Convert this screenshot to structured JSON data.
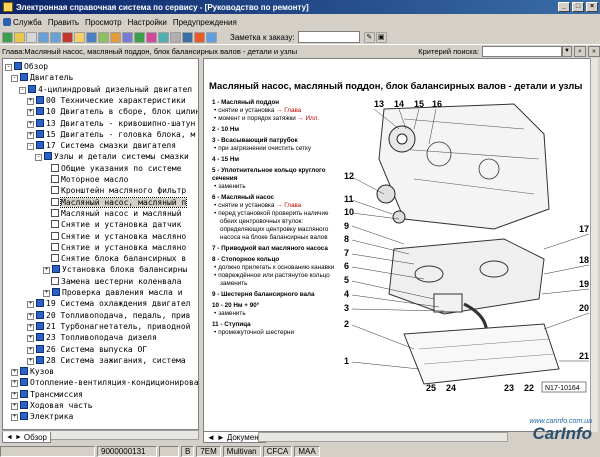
{
  "window": {
    "title": "Электронная справочная система по сервису - [Руководство по ремонту]"
  },
  "menu": [
    {
      "label": "Служба"
    },
    {
      "label": "Править"
    },
    {
      "label": "Просмотр"
    },
    {
      "label": "Настройки"
    },
    {
      "label": "Предупреждения"
    }
  ],
  "toolbar": {
    "order_note_label": "Заметка к заказу:"
  },
  "pathbar": {
    "chapter": "Глава:Масляный насос, масляный поддон, блок балансирных валов - детали и узлы",
    "criteria_label": "Критерий поиска:"
  },
  "tree": {
    "items": [
      {
        "label": "Обзор",
        "exp": "-",
        "icon": "book"
      },
      {
        "label": "Двигатель",
        "exp": "-",
        "icon": "book"
      },
      {
        "label": "4-цилиндровый дизельный двигател",
        "exp": "-",
        "icon": "book"
      },
      {
        "label": "00 Технические характеристики",
        "exp": "+",
        "icon": "book"
      },
      {
        "label": "10 Двигатель в сборе, блок цилин",
        "exp": "+",
        "icon": "book"
      },
      {
        "label": "13 Двигатель - кривошипно-шатун",
        "exp": "+",
        "icon": "book"
      },
      {
        "label": "15 Двигатель - головка блока, м",
        "exp": "+",
        "icon": "book"
      },
      {
        "label": "17 Система смазки двигателя",
        "exp": "-",
        "icon": "book"
      },
      {
        "label": "Узлы и детали системы смазки",
        "exp": "-",
        "icon": "book"
      },
      {
        "label": "Общие указания по системе",
        "exp": "",
        "icon": "doc"
      },
      {
        "label": "Моторное масло",
        "exp": "",
        "icon": "doc"
      },
      {
        "label": "Кронштейн масляного фильтр",
        "exp": "",
        "icon": "doc"
      },
      {
        "label": "Масляный насос, масляный п",
        "exp": "",
        "icon": "doc",
        "selected": true
      },
      {
        "label": "Масляный насос и масляный",
        "exp": "",
        "icon": "doc"
      },
      {
        "label": "Снятие и установка  датчик",
        "exp": "",
        "icon": "doc"
      },
      {
        "label": "Снятие и установка масляно",
        "exp": "",
        "icon": "doc"
      },
      {
        "label": "Снятие и установка масляно",
        "exp": "",
        "icon": "doc"
      },
      {
        "label": "Снятие блока балансирных в",
        "exp": "",
        "icon": "doc"
      },
      {
        "label": "Установка блока балансирны",
        "exp": "+",
        "icon": "book"
      },
      {
        "label": "Замена шестерни коленвала",
        "exp": "",
        "icon": "doc"
      },
      {
        "label": "Проверка давления масла и",
        "exp": "+",
        "icon": "book"
      },
      {
        "label": "19 Система охлаждения двигател",
        "exp": "+",
        "icon": "book"
      },
      {
        "label": "20 Топливоподача, педаль, прив",
        "exp": "+",
        "icon": "book"
      },
      {
        "label": "21 Турбонагнетатель, приводной",
        "exp": "+",
        "icon": "book"
      },
      {
        "label": "23 Топливоподача дизеля",
        "exp": "+",
        "icon": "book"
      },
      {
        "label": "26 Система выпуска ОГ",
        "exp": "+",
        "icon": "book"
      },
      {
        "label": "28 Система зажигания, система",
        "exp": "+",
        "icon": "book"
      },
      {
        "label": "Кузов",
        "exp": "+",
        "icon": "book"
      },
      {
        "label": "Отопление-вентиляция-кондиционирован",
        "exp": "+",
        "icon": "book"
      },
      {
        "label": "Трансмиссия",
        "exp": "+",
        "icon": "book"
      },
      {
        "label": "Ходовая часть",
        "exp": "+",
        "icon": "book"
      },
      {
        "label": "Электрика",
        "exp": "+",
        "icon": "book"
      }
    ],
    "tab_label": "Обзор"
  },
  "doc": {
    "title": "Масляный насос, масляный поддон, блок балансирных валов - детали и узлы",
    "tab_label": "Документ",
    "legend": [
      {
        "head": "1 - Масляный поддон",
        "subs": [
          {
            "text": "снятие и установка",
            "link": "→ Глава"
          },
          {
            "text": "момент и порядок затяжки",
            "link": "→ Илл."
          }
        ]
      },
      {
        "head": "2 - 10 Нм",
        "subs": []
      },
      {
        "head": "3 - Всасывающий патрубок",
        "subs": [
          {
            "text": "при загрязнении очистить сетку",
            "link": ""
          }
        ]
      },
      {
        "head": "4 - 15 Нм",
        "subs": []
      },
      {
        "head": "5 - Уплотнительное кольцо круглого сечения",
        "subs": [
          {
            "text": "заменить",
            "link": ""
          }
        ]
      },
      {
        "head": "6 - Масляный насос",
        "subs": [
          {
            "text": "снятие и установка",
            "link": "→ Глава"
          },
          {
            "text": "перед установкой проверить наличие обеих центровочных втулок: определяющих центровку масляного насоса на блоке балансирных валов",
            "link": ""
          }
        ]
      },
      {
        "head": "7 - Приводной вал масляного насоса",
        "subs": []
      },
      {
        "head": "8 - Стопорное кольцо",
        "subs": [
          {
            "text": "должно прилегать к основанию канавки",
            "link": ""
          },
          {
            "text": "повреждённое или растянутое кольцо заменить",
            "link": ""
          }
        ]
      },
      {
        "head": "9 - Шестерня балансирного вала",
        "subs": []
      },
      {
        "head": "10 - 20 Нм + 90°",
        "subs": [
          {
            "text": "заменить",
            "link": ""
          }
        ]
      },
      {
        "head": "11 - Ступица",
        "subs": [
          {
            "text": "промежуточной шестерни",
            "link": ""
          }
        ]
      }
    ],
    "diagram": {
      "callouts": [
        "13",
        "14",
        "15",
        "16",
        "12",
        "11",
        "10",
        "9",
        "8",
        "7",
        "6",
        "5",
        "4",
        "3",
        "2",
        "1",
        "17",
        "18",
        "19",
        "20",
        "21",
        "25",
        "24",
        "23",
        "22"
      ],
      "figure_code": "N17-10164"
    }
  },
  "status": {
    "cells": [
      "9000000131",
      "B",
      "7EM",
      "Multivan",
      "CFCA",
      "MAA"
    ]
  },
  "brand": {
    "url": "www.carinfo.com.ua",
    "logo": "CarInfo"
  }
}
